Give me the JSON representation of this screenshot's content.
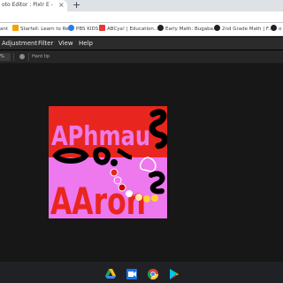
{
  "browser": {
    "tab_title": "oto Editor : Pixlr E - free imag",
    "tab_close": "×",
    "new_tab": "+"
  },
  "bookmarks": [
    {
      "label": "ant",
      "color": "#5f6368"
    },
    {
      "label": "Starfall: Learn to Re...",
      "color": "#f4a300"
    },
    {
      "label": "PBS KIDS",
      "color": "#2a7de1"
    },
    {
      "label": "ABCya! | Education...",
      "color": "#e53935"
    },
    {
      "label": "Early Math: Bugaba...",
      "color": "#202124"
    },
    {
      "label": "2nd Grade Math | F...",
      "color": "#202124"
    },
    {
      "label": "o",
      "color": "#202124"
    }
  ],
  "menu": [
    "Adjustment",
    "Filter",
    "View",
    "Help"
  ],
  "toolbar": {
    "zoom_value": "%",
    "brush_label": "Hard tip"
  },
  "canvas": {
    "top_color": "#e8261f",
    "bottom_color": "#ee78ee",
    "text_top": "APhmau",
    "text_bottom": "AAron"
  },
  "taskbar": {
    "apps": [
      "google-drive",
      "google-meet",
      "chrome",
      "google-play"
    ]
  }
}
